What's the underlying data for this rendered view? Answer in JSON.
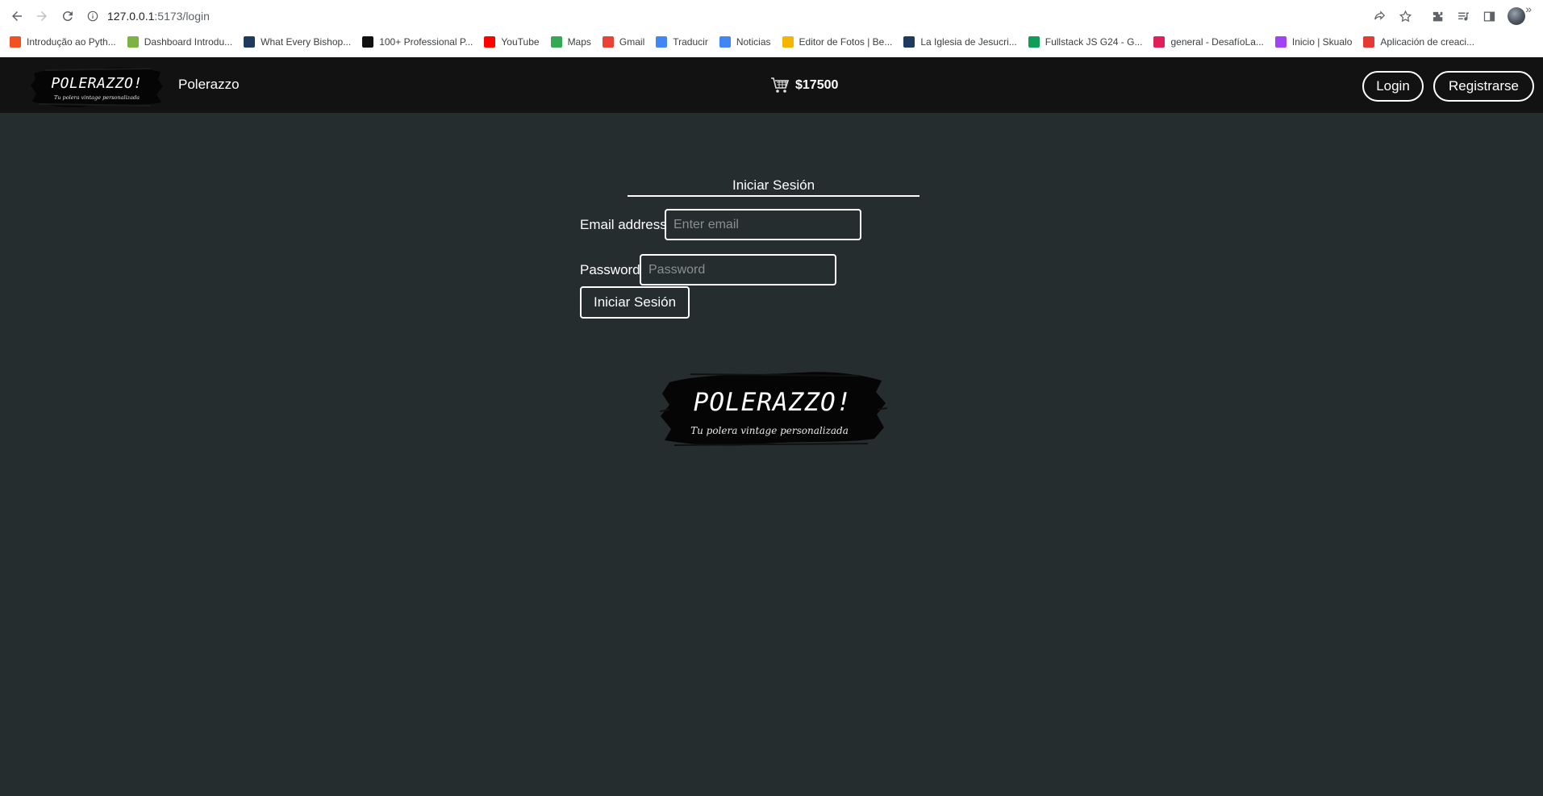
{
  "browser": {
    "url_host": "127.0.0.1",
    "url_path": ":5173/login",
    "bookmarks": [
      {
        "label": "Introdução ao Pyth...",
        "icon": "microsoft-icon",
        "color": "#f25022"
      },
      {
        "label": "Dashboard Introdu...",
        "icon": "dashboard-icon",
        "color": "#7cb342"
      },
      {
        "label": "What Every Bishop...",
        "icon": "church-icon",
        "color": "#1f3a5f"
      },
      {
        "label": "100+ Professional P...",
        "icon": "squares-icon",
        "color": "#111111"
      },
      {
        "label": "YouTube",
        "icon": "youtube-icon",
        "color": "#ff0000"
      },
      {
        "label": "Maps",
        "icon": "maps-icon",
        "color": "#34a853"
      },
      {
        "label": "Gmail",
        "icon": "gmail-icon",
        "color": "#ea4335"
      },
      {
        "label": "Traducir",
        "icon": "translate-icon",
        "color": "#4285f4"
      },
      {
        "label": "Noticias",
        "icon": "news-icon",
        "color": "#4285f4"
      },
      {
        "label": "Editor de Fotos | Be...",
        "icon": "photo-editor-icon",
        "color": "#f4b400"
      },
      {
        "label": "La Iglesia de Jesucri...",
        "icon": "church-icon",
        "color": "#1f3a5f"
      },
      {
        "label": "Fullstack JS G24 - G...",
        "icon": "drive-icon",
        "color": "#0f9d58"
      },
      {
        "label": "general - DesafíoLa...",
        "icon": "slack-icon",
        "color": "#e01e5a"
      },
      {
        "label": "Inicio | Skualo",
        "icon": "skualo-icon",
        "color": "#a142f4"
      },
      {
        "label": "Aplicación de creaci...",
        "icon": "canva-icon",
        "color": "#e53935"
      }
    ]
  },
  "navbar": {
    "logo_text": "POLERAZZO!",
    "logo_tagline": "Tu polera vintage personalizada",
    "brand": "Polerazzo",
    "cart_total": "$17500",
    "login_label": "Login",
    "register_label": "Registrarse"
  },
  "login_form": {
    "title": "Iniciar Sesión",
    "email_label": "Email address",
    "email_placeholder": "Enter email",
    "email_value": "",
    "password_label": "Password",
    "password_placeholder": "Password",
    "password_value": "",
    "submit_label": "Iniciar Sesión"
  },
  "footer_logo": {
    "text": "POLERAZZO!",
    "tagline": "Tu polera vintage personalizada"
  },
  "colors": {
    "page_bg": "#252d2e",
    "navbar_bg": "#121212",
    "text": "#ffffff"
  }
}
